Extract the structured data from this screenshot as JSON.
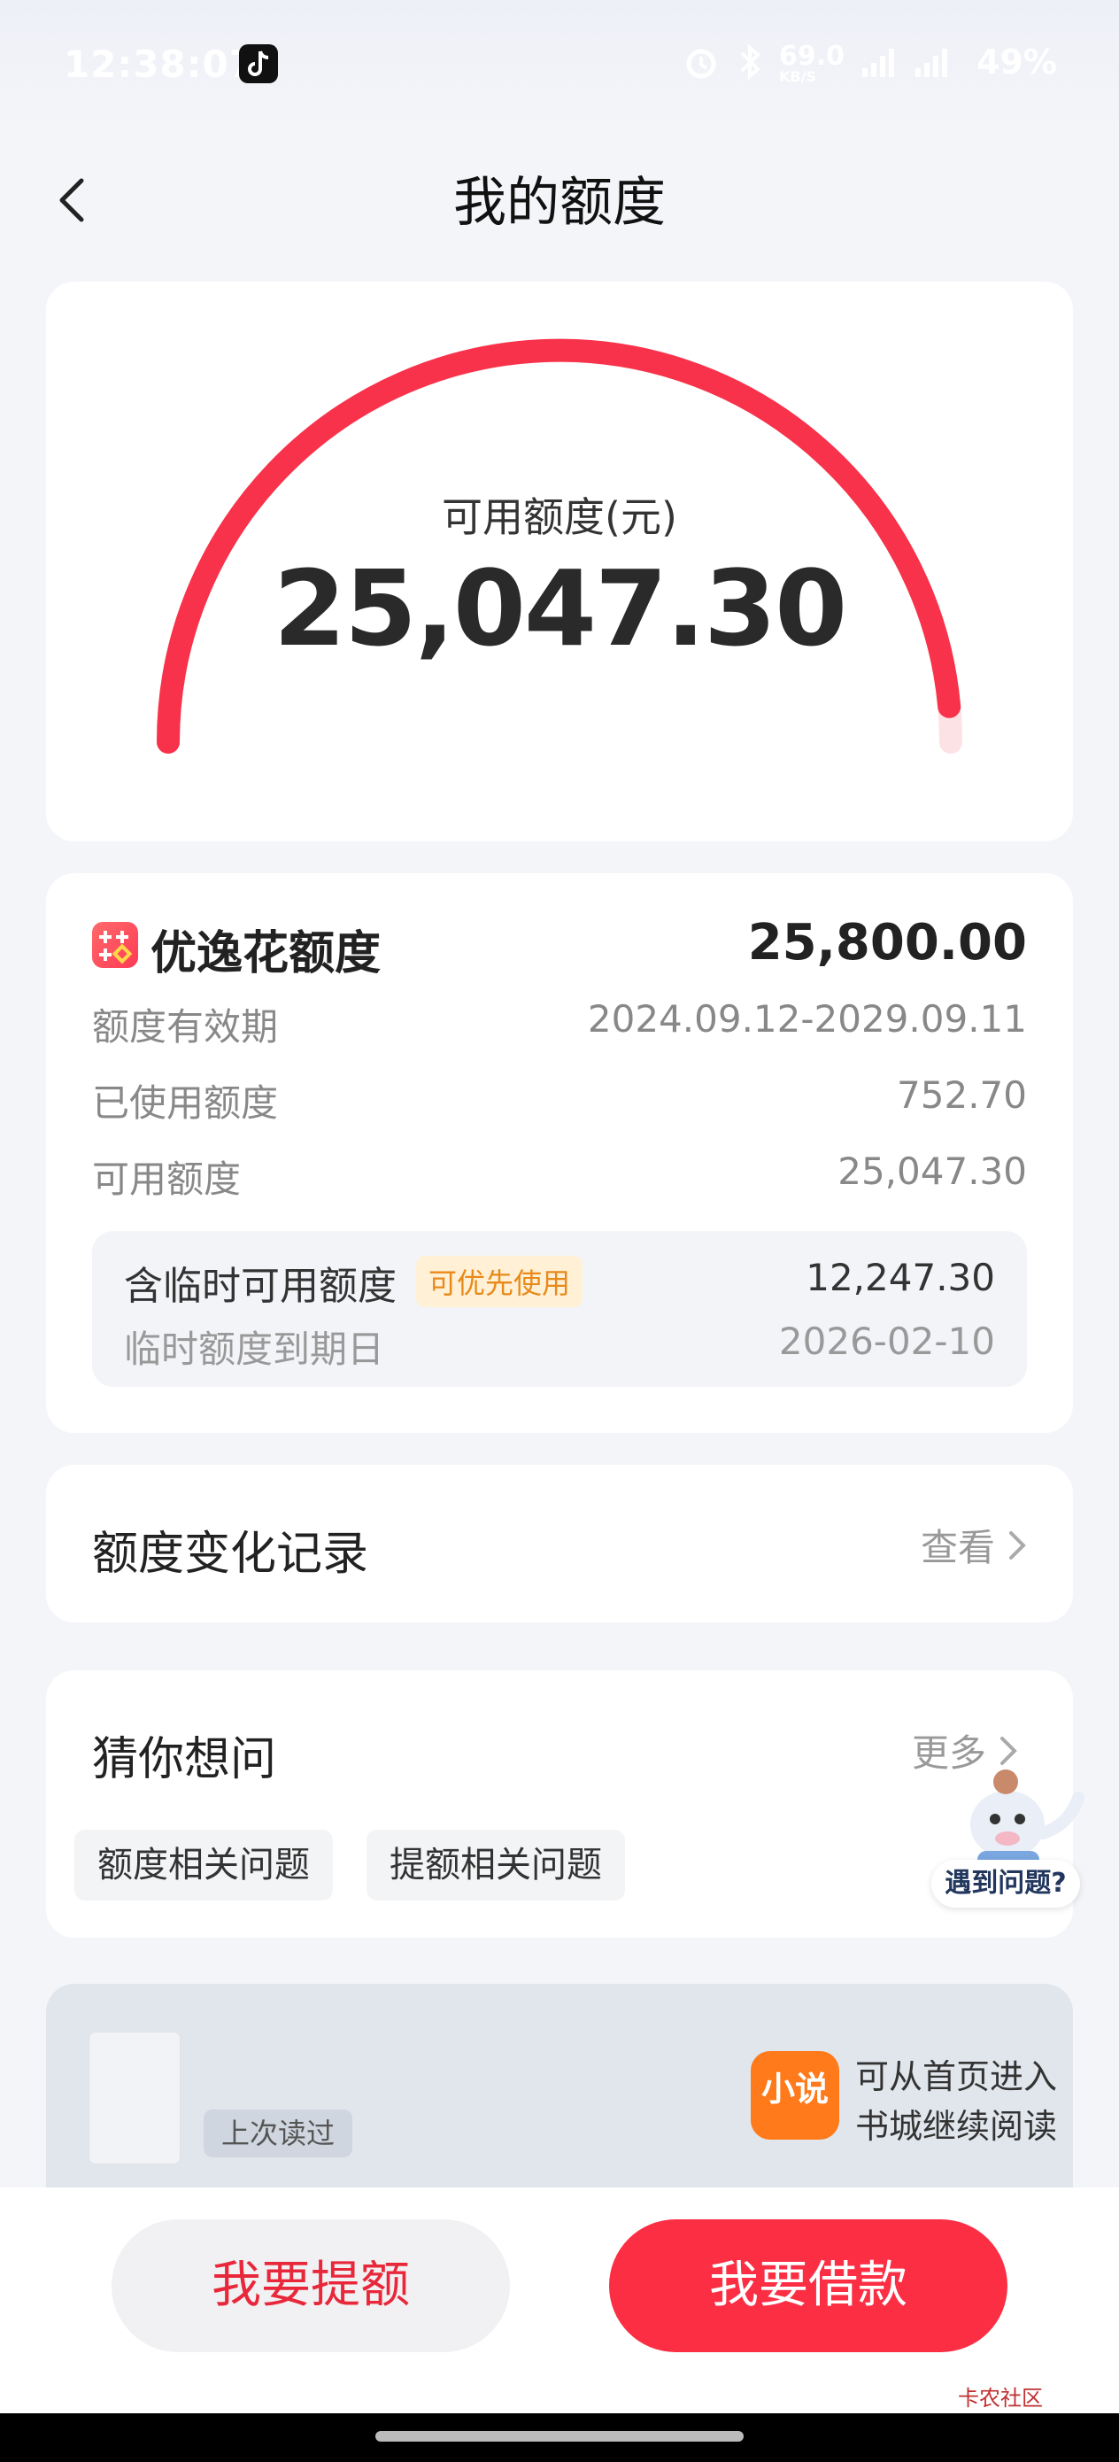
{
  "status_bar": {
    "time": "12:38:07",
    "net_speed": "69.0",
    "net_unit": "KB/S",
    "battery": "49%",
    "icons": [
      "tiktok-icon",
      "alarm-icon",
      "bluetooth-icon",
      "signal-icon",
      "signal-5g-icon"
    ]
  },
  "nav": {
    "title": "我的额度"
  },
  "gauge": {
    "label": "可用额度(元)",
    "amount": "25,047.30",
    "progress": 0.971,
    "color": "#f8324a",
    "track_color": "#fde2e5"
  },
  "limit": {
    "title": "优逸花额度",
    "total": "25,800.00",
    "rows": [
      {
        "label": "额度有效期",
        "value": "2024.09.12-2029.09.11"
      },
      {
        "label": "已使用额度",
        "value": "752.70"
      },
      {
        "label": "可用额度",
        "value": "25,047.30"
      }
    ],
    "temp": {
      "label": "含临时可用额度",
      "badge": "可优先使用",
      "value": "12,247.30",
      "expiry_label": "临时额度到期日",
      "expiry_value": "2026-02-10"
    }
  },
  "record": {
    "title": "额度变化记录",
    "link": "查看"
  },
  "guess": {
    "title": "猜你想问",
    "more": "更多",
    "chips": [
      "额度相关问题",
      "提额相关问题"
    ],
    "mascot_label": "遇到问题?"
  },
  "read_banner": {
    "last_read": "上次读过",
    "logo_text": "小说",
    "line1": "可从首页进入",
    "line2": "书城继续阅读"
  },
  "actions": {
    "raise_limit": "我要提额",
    "borrow": "我要借款"
  },
  "watermark": "卡农社区"
}
